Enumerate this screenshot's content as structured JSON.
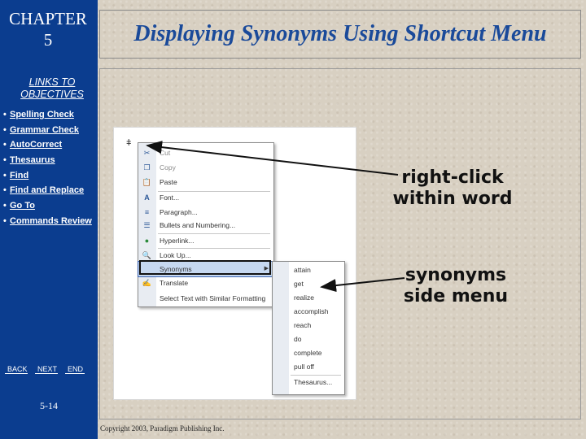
{
  "sidebar": {
    "chapter_line1": "CHAPTER",
    "chapter_line2": "5",
    "links_title_line1": "LINKS TO",
    "links_title_line2": "OBJECTIVES",
    "objectives": [
      {
        "label": "Spelling Check"
      },
      {
        "label": "Grammar Check"
      },
      {
        "label": "AutoCorrect"
      },
      {
        "label": "Thesaurus"
      },
      {
        "label": "Find"
      },
      {
        "label": "Find and Replace"
      },
      {
        "label": "Go To"
      },
      {
        "label": "Commands Review"
      }
    ],
    "nav": {
      "back": "BACK",
      "next": "NEXT",
      "end": "END"
    },
    "page_number": "5-14"
  },
  "title": "Displaying Synonyms Using Shortcut Menu",
  "context_menu": {
    "items": [
      {
        "label": "Cut",
        "icon": "scissors-icon"
      },
      {
        "label": "Copy",
        "icon": "copy-icon"
      },
      {
        "label": "Paste",
        "icon": "paste-icon"
      },
      {
        "label": "Font...",
        "icon": "font-icon"
      },
      {
        "label": "Paragraph...",
        "icon": "paragraph-icon"
      },
      {
        "label": "Bullets and Numbering...",
        "icon": "bullets-icon"
      },
      {
        "label": "Hyperlink...",
        "icon": "hyperlink-icon"
      },
      {
        "label": "Look Up...",
        "icon": "lookup-icon"
      },
      {
        "label": "Synonyms",
        "icon": ""
      },
      {
        "label": "Translate",
        "icon": "translate-icon"
      },
      {
        "label": "Select Text with Similar Formatting",
        "icon": ""
      }
    ]
  },
  "synonyms_menu": {
    "items": [
      {
        "label": "attain"
      },
      {
        "label": "get"
      },
      {
        "label": "realize"
      },
      {
        "label": "accomplish"
      },
      {
        "label": "reach"
      },
      {
        "label": "do"
      },
      {
        "label": "complete"
      },
      {
        "label": "pull off"
      },
      {
        "label": "Thesaurus..."
      }
    ]
  },
  "callouts": {
    "right_click_line1": "right-click",
    "right_click_line2": "within word",
    "synonyms_line1": "synonyms",
    "synonyms_line2": "side menu"
  },
  "copyright": "Copyright 2003, Paradigm Publishing Inc.",
  "colors": {
    "sidebar": "#0b3d8f",
    "title": "#1a4a9a",
    "menu_highlight": "#c6d8f0"
  }
}
